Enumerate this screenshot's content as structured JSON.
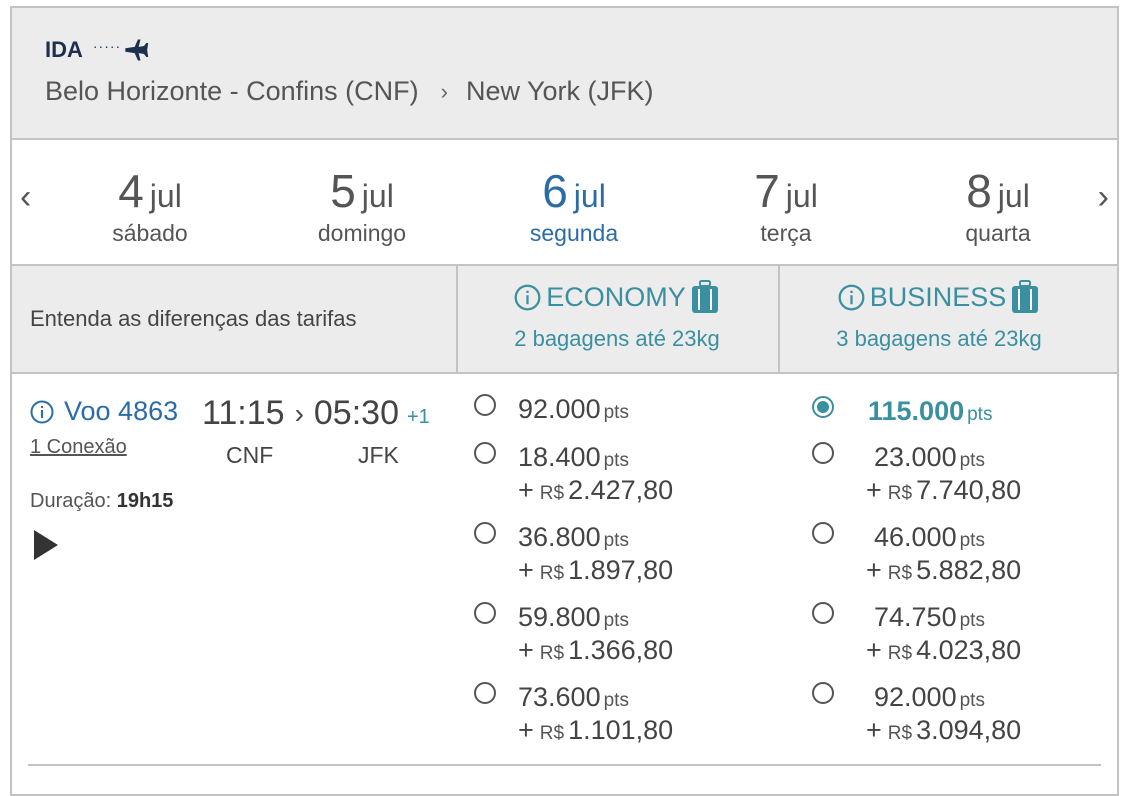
{
  "header": {
    "label": "IDA",
    "dots": "·····",
    "origin": "Belo Horizonte - Confins (CNF)",
    "destination": "New York (JFK)"
  },
  "dates": [
    {
      "num": "4",
      "month": "jul",
      "weekday": "sábado"
    },
    {
      "num": "5",
      "month": "jul",
      "weekday": "domingo"
    },
    {
      "num": "6",
      "month": "jul",
      "weekday": "segunda"
    },
    {
      "num": "7",
      "month": "jul",
      "weekday": "terça"
    },
    {
      "num": "8",
      "month": "jul",
      "weekday": "quarta"
    }
  ],
  "nav": {
    "prev": "‹",
    "next": "›"
  },
  "fares": {
    "info_text": "Entenda as diferenças das tarifas",
    "economy": {
      "title": "ECONOMY",
      "bags": "2 bagagens até 23kg"
    },
    "business": {
      "title": "BUSINESS",
      "bags": "3 bagagens até 23kg"
    }
  },
  "flight": {
    "number": "Voo 4863",
    "connections": "1 Conexão",
    "duration_label": "Duração:",
    "duration": "19h15",
    "depart_time": "11:15",
    "arrive_time": "05:30",
    "day_offset": "+1",
    "depart_airport": "CNF",
    "arrive_airport": "JFK"
  },
  "units": {
    "pts": "pts",
    "plus": "+",
    "currency": "R$"
  },
  "economy_options": [
    {
      "points": "92.000",
      "cash": ""
    },
    {
      "points": "18.400",
      "cash": "2.427,80"
    },
    {
      "points": "36.800",
      "cash": "1.897,80"
    },
    {
      "points": "59.800",
      "cash": "1.366,80"
    },
    {
      "points": "73.600",
      "cash": "1.101,80"
    }
  ],
  "business_options": [
    {
      "points": "115.000",
      "cash": "",
      "selected": true
    },
    {
      "points": "23.000",
      "cash": "7.740,80"
    },
    {
      "points": "46.000",
      "cash": "5.882,80"
    },
    {
      "points": "74.750",
      "cash": "4.023,80"
    },
    {
      "points": "92.000",
      "cash": "3.094,80"
    }
  ],
  "colors": {
    "accent": "#3a8fa1",
    "active_date": "#2b6ca6",
    "header_bg": "#ececec"
  }
}
